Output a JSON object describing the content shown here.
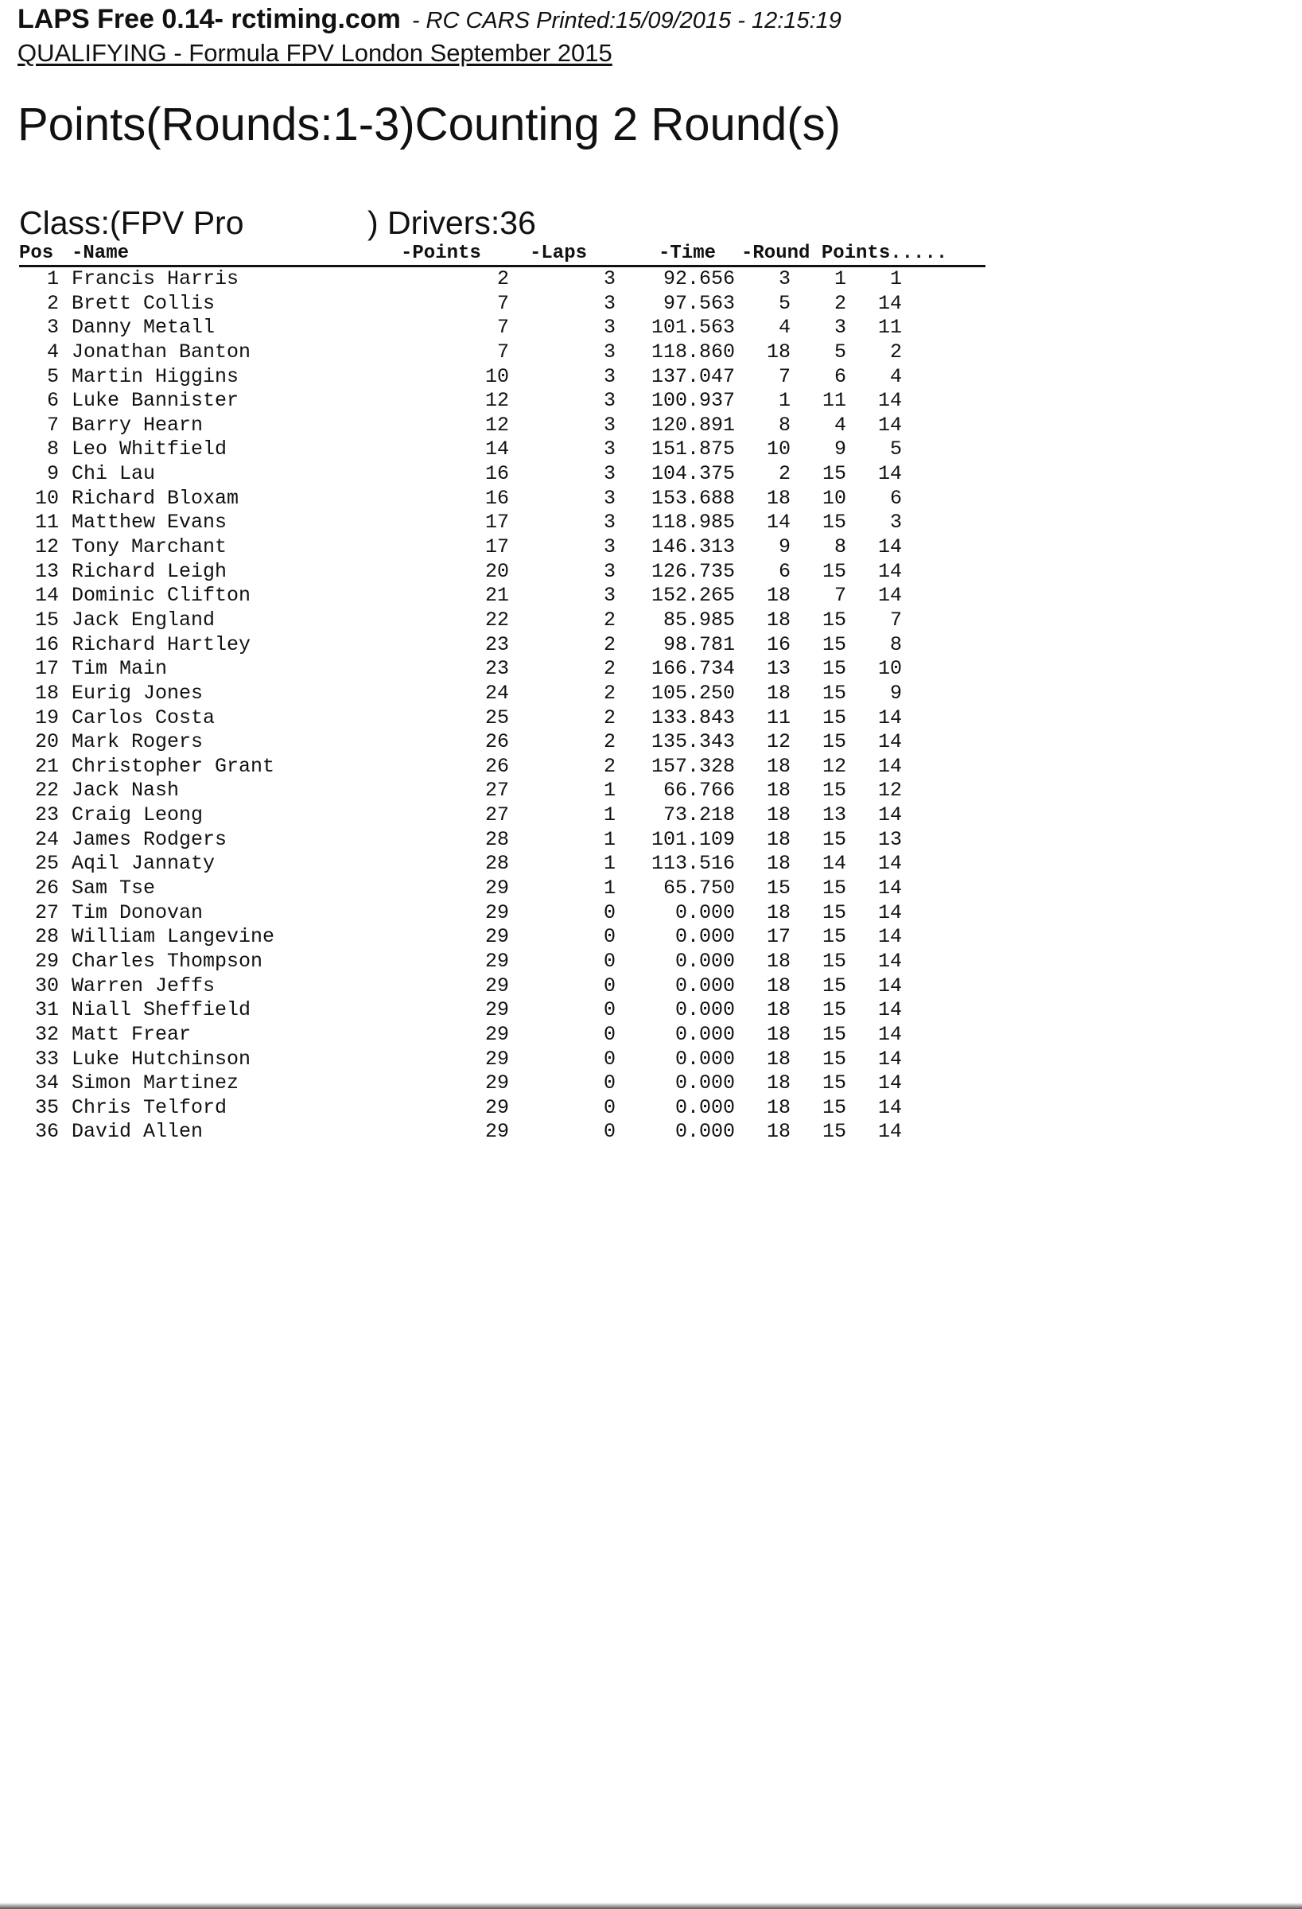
{
  "header": {
    "program": "LAPS Free 0.14- rctiming.com",
    "meta": "- RC CARS Printed:15/09/2015 - 12:15:19",
    "event": "QUALIFYING - Formula FPV London September 2015"
  },
  "title": "Points(Rounds:1-3)Counting 2 Round(s)",
  "class_info": {
    "class_label": "Class:(FPV Pro",
    "drivers_label": ") Drivers:36"
  },
  "columns": {
    "pos": "Pos",
    "name": "-Name",
    "points": "-Points",
    "laps": "-Laps",
    "time": "-Time",
    "round_points": "-Round Points....."
  },
  "rows": [
    {
      "pos": "1",
      "name": "Francis Harris",
      "points": "2",
      "laps": "3",
      "time": "92.656",
      "r1": "3",
      "r2": "1",
      "r3": "1"
    },
    {
      "pos": "2",
      "name": "Brett Collis",
      "points": "7",
      "laps": "3",
      "time": "97.563",
      "r1": "5",
      "r2": "2",
      "r3": "14"
    },
    {
      "pos": "3",
      "name": "Danny Metall",
      "points": "7",
      "laps": "3",
      "time": "101.563",
      "r1": "4",
      "r2": "3",
      "r3": "11"
    },
    {
      "pos": "4",
      "name": "Jonathan Banton",
      "points": "7",
      "laps": "3",
      "time": "118.860",
      "r1": "18",
      "r2": "5",
      "r3": "2"
    },
    {
      "pos": "5",
      "name": "Martin Higgins",
      "points": "10",
      "laps": "3",
      "time": "137.047",
      "r1": "7",
      "r2": "6",
      "r3": "4"
    },
    {
      "pos": "6",
      "name": "Luke Bannister",
      "points": "12",
      "laps": "3",
      "time": "100.937",
      "r1": "1",
      "r2": "11",
      "r3": "14"
    },
    {
      "pos": "7",
      "name": "Barry Hearn",
      "points": "12",
      "laps": "3",
      "time": "120.891",
      "r1": "8",
      "r2": "4",
      "r3": "14"
    },
    {
      "pos": "8",
      "name": "Leo Whitfield",
      "points": "14",
      "laps": "3",
      "time": "151.875",
      "r1": "10",
      "r2": "9",
      "r3": "5"
    },
    {
      "pos": "9",
      "name": "Chi Lau",
      "points": "16",
      "laps": "3",
      "time": "104.375",
      "r1": "2",
      "r2": "15",
      "r3": "14"
    },
    {
      "pos": "10",
      "name": "Richard Bloxam",
      "points": "16",
      "laps": "3",
      "time": "153.688",
      "r1": "18",
      "r2": "10",
      "r3": "6"
    },
    {
      "pos": "11",
      "name": "Matthew Evans",
      "points": "17",
      "laps": "3",
      "time": "118.985",
      "r1": "14",
      "r2": "15",
      "r3": "3"
    },
    {
      "pos": "12",
      "name": "Tony Marchant",
      "points": "17",
      "laps": "3",
      "time": "146.313",
      "r1": "9",
      "r2": "8",
      "r3": "14"
    },
    {
      "pos": "13",
      "name": "Richard Leigh",
      "points": "20",
      "laps": "3",
      "time": "126.735",
      "r1": "6",
      "r2": "15",
      "r3": "14"
    },
    {
      "pos": "14",
      "name": "Dominic Clifton",
      "points": "21",
      "laps": "3",
      "time": "152.265",
      "r1": "18",
      "r2": "7",
      "r3": "14"
    },
    {
      "pos": "15",
      "name": "Jack England",
      "points": "22",
      "laps": "2",
      "time": "85.985",
      "r1": "18",
      "r2": "15",
      "r3": "7"
    },
    {
      "pos": "16",
      "name": "Richard Hartley",
      "points": "23",
      "laps": "2",
      "time": "98.781",
      "r1": "16",
      "r2": "15",
      "r3": "8"
    },
    {
      "pos": "17",
      "name": "Tim Main",
      "points": "23",
      "laps": "2",
      "time": "166.734",
      "r1": "13",
      "r2": "15",
      "r3": "10"
    },
    {
      "pos": "18",
      "name": "Eurig Jones",
      "points": "24",
      "laps": "2",
      "time": "105.250",
      "r1": "18",
      "r2": "15",
      "r3": "9"
    },
    {
      "pos": "19",
      "name": "Carlos Costa",
      "points": "25",
      "laps": "2",
      "time": "133.843",
      "r1": "11",
      "r2": "15",
      "r3": "14"
    },
    {
      "pos": "20",
      "name": "Mark Rogers",
      "points": "26",
      "laps": "2",
      "time": "135.343",
      "r1": "12",
      "r2": "15",
      "r3": "14"
    },
    {
      "pos": "21",
      "name": "Christopher Grant",
      "points": "26",
      "laps": "2",
      "time": "157.328",
      "r1": "18",
      "r2": "12",
      "r3": "14"
    },
    {
      "pos": "22",
      "name": "Jack Nash",
      "points": "27",
      "laps": "1",
      "time": "66.766",
      "r1": "18",
      "r2": "15",
      "r3": "12"
    },
    {
      "pos": "23",
      "name": "Craig Leong",
      "points": "27",
      "laps": "1",
      "time": "73.218",
      "r1": "18",
      "r2": "13",
      "r3": "14"
    },
    {
      "pos": "24",
      "name": "James Rodgers",
      "points": "28",
      "laps": "1",
      "time": "101.109",
      "r1": "18",
      "r2": "15",
      "r3": "13"
    },
    {
      "pos": "25",
      "name": "Aqil Jannaty",
      "points": "28",
      "laps": "1",
      "time": "113.516",
      "r1": "18",
      "r2": "14",
      "r3": "14"
    },
    {
      "pos": "26",
      "name": "Sam Tse",
      "points": "29",
      "laps": "1",
      "time": "65.750",
      "r1": "15",
      "r2": "15",
      "r3": "14"
    },
    {
      "pos": "27",
      "name": "Tim Donovan",
      "points": "29",
      "laps": "0",
      "time": "0.000",
      "r1": "18",
      "r2": "15",
      "r3": "14"
    },
    {
      "pos": "28",
      "name": "William Langevine",
      "points": "29",
      "laps": "0",
      "time": "0.000",
      "r1": "17",
      "r2": "15",
      "r3": "14"
    },
    {
      "pos": "29",
      "name": "Charles Thompson",
      "points": "29",
      "laps": "0",
      "time": "0.000",
      "r1": "18",
      "r2": "15",
      "r3": "14"
    },
    {
      "pos": "30",
      "name": "Warren Jeffs",
      "points": "29",
      "laps": "0",
      "time": "0.000",
      "r1": "18",
      "r2": "15",
      "r3": "14"
    },
    {
      "pos": "31",
      "name": "Niall Sheffield",
      "points": "29",
      "laps": "0",
      "time": "0.000",
      "r1": "18",
      "r2": "15",
      "r3": "14"
    },
    {
      "pos": "32",
      "name": "Matt Frear",
      "points": "29",
      "laps": "0",
      "time": "0.000",
      "r1": "18",
      "r2": "15",
      "r3": "14"
    },
    {
      "pos": "33",
      "name": "Luke Hutchinson",
      "points": "29",
      "laps": "0",
      "time": "0.000",
      "r1": "18",
      "r2": "15",
      "r3": "14"
    },
    {
      "pos": "34",
      "name": "Simon Martinez",
      "points": "29",
      "laps": "0",
      "time": "0.000",
      "r1": "18",
      "r2": "15",
      "r3": "14"
    },
    {
      "pos": "35",
      "name": "Chris Telford",
      "points": "29",
      "laps": "0",
      "time": "0.000",
      "r1": "18",
      "r2": "15",
      "r3": "14"
    },
    {
      "pos": "36",
      "name": "David Allen",
      "points": "29",
      "laps": "0",
      "time": "0.000",
      "r1": "18",
      "r2": "15",
      "r3": "14"
    }
  ]
}
